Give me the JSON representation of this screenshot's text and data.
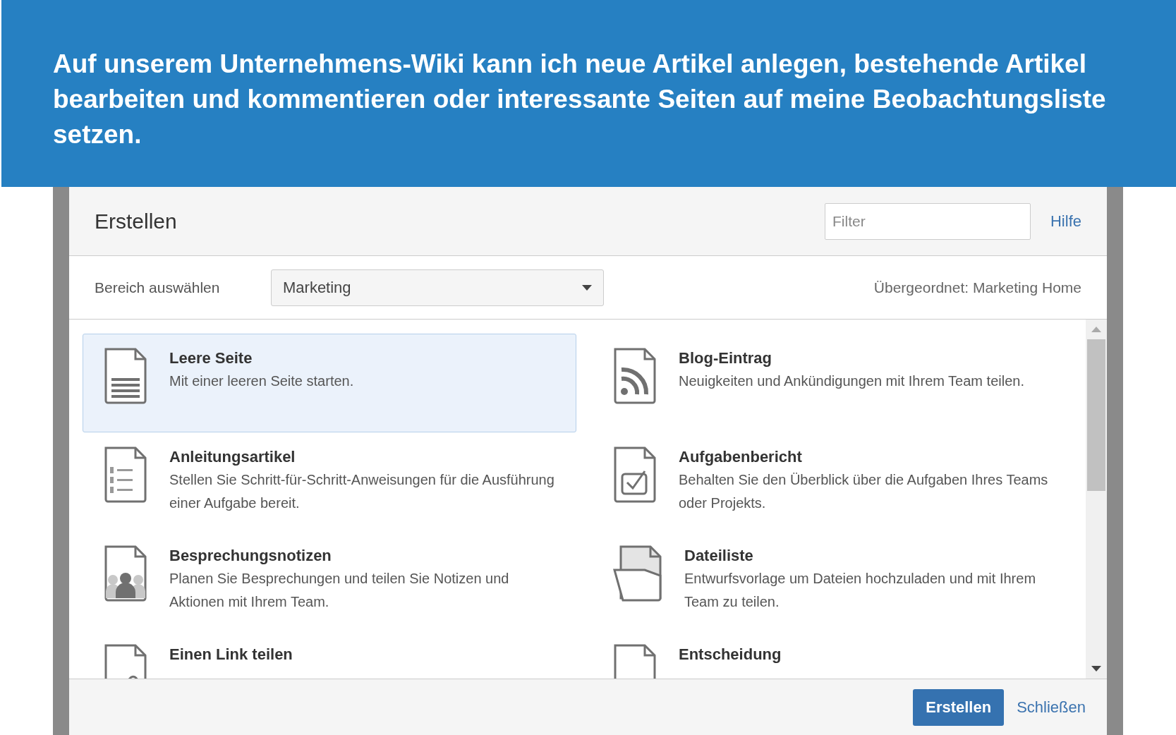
{
  "banner": {
    "text": "Auf unserem Unternehmens-Wiki kann ich neue Artikel anlegen, bestehende Artikel bearbeiten und kommentieren oder interessante Seiten auf meine Beobachtungsliste setzen."
  },
  "dialog": {
    "title": "Erstellen",
    "filter": {
      "placeholder": "Filter"
    },
    "help_link": "Hilfe",
    "space_label": "Bereich auswählen",
    "space_select": {
      "value": "Marketing"
    },
    "parent": "Übergeordnet: Marketing Home",
    "templates": [
      {
        "kind": "blank",
        "title": "Leere Seite",
        "description": "Mit einer leeren Seite starten.",
        "selected": true
      },
      {
        "kind": "blog",
        "title": "Blog-Eintrag",
        "description": "Neuigkeiten und Ankündigungen mit Ihrem Team teilen.",
        "selected": false
      },
      {
        "kind": "howto",
        "title": "Anleitungsartikel",
        "description": "Stellen Sie Schritt-für-Schritt-Anweisungen für die Ausführung einer Aufgabe bereit.",
        "selected": false
      },
      {
        "kind": "task",
        "title": "Aufgabenbericht",
        "description": "Behalten Sie den Überblick über die Aufgaben Ihres Teams oder Projekts.",
        "selected": false
      },
      {
        "kind": "meeting",
        "title": "Besprechungsnotizen",
        "description": "Planen Sie Besprechungen und teilen Sie Notizen und Aktionen mit Ihrem Team.",
        "selected": false
      },
      {
        "kind": "files",
        "title": "Dateiliste",
        "description": "Entwurfsvorlage um Dateien hochzuladen und mit Ihrem Team zu teilen.",
        "selected": false
      },
      {
        "kind": "link",
        "title": "Einen Link teilen",
        "selected": false
      },
      {
        "kind": "decision",
        "title": "Entscheidung",
        "selected": false
      }
    ],
    "buttons": [
      {
        "kind": "primary",
        "label": "Erstellen"
      },
      {
        "kind": "link",
        "label": "Schließen"
      }
    ]
  }
}
